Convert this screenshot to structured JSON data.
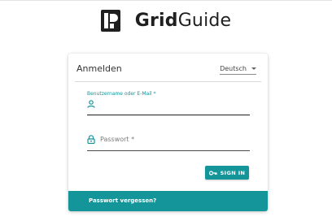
{
  "brand": {
    "name_bold": "Grid",
    "name_regular": "Guide"
  },
  "card": {
    "title": "Anmelden"
  },
  "language": {
    "selected": "Deutsch"
  },
  "username": {
    "label": "Benutzername oder E-Mail *",
    "value": ""
  },
  "password": {
    "placeholder": "Passwort *",
    "value": ""
  },
  "buttons": {
    "sign_in": "SIGN IN"
  },
  "footer": {
    "forgot_password": "Passwort vergessen?"
  },
  "colors": {
    "accent": "#13959a",
    "text": "#1f1f1f"
  },
  "icons": {
    "logo": "gridguide-logo-icon",
    "user": "person-icon",
    "lock": "lock-icon",
    "key": "key-icon",
    "dropdown": "caret-down-icon"
  }
}
